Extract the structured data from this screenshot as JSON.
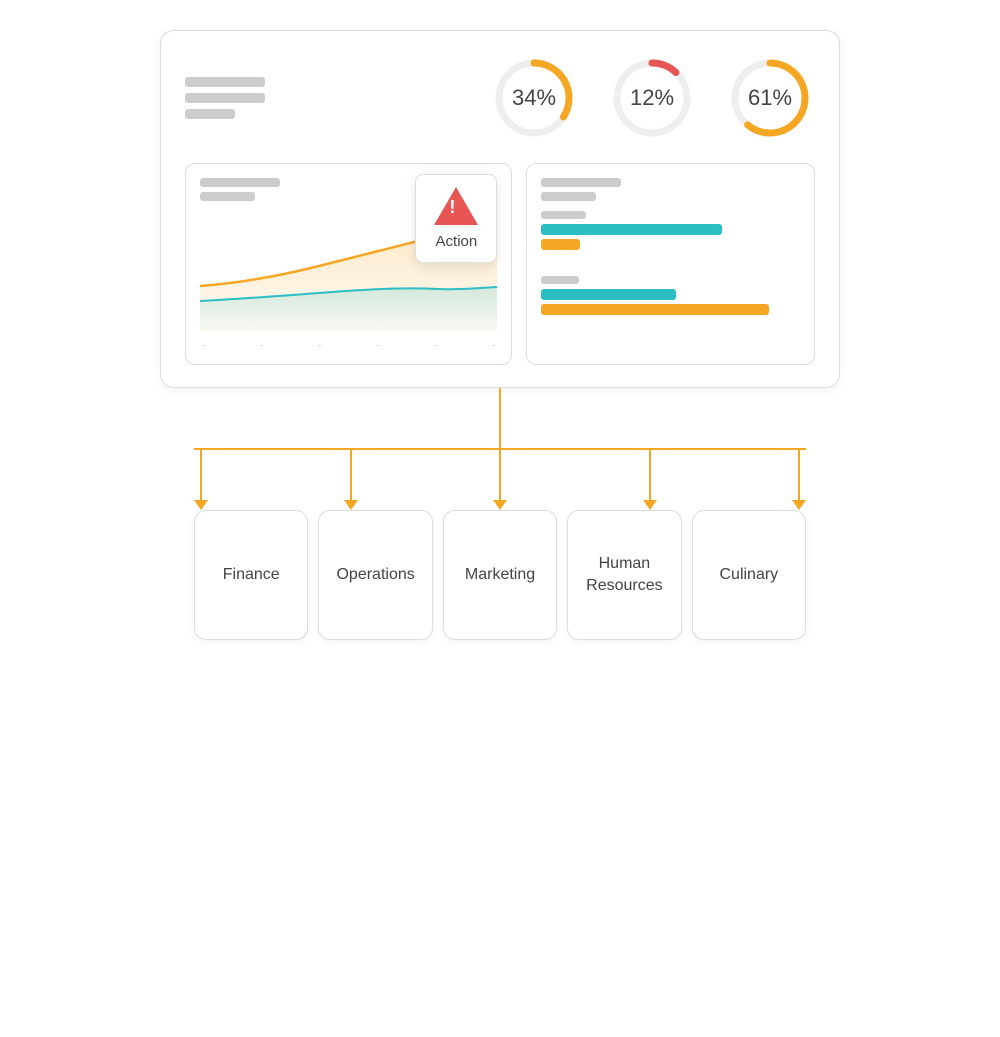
{
  "gauges": [
    {
      "id": "gauge1",
      "value": 34,
      "label": "34%",
      "color": "#f5a623",
      "bg": "#eee",
      "pct": 34
    },
    {
      "id": "gauge2",
      "value": 12,
      "label": "12%",
      "color": "#e85555",
      "bg": "#eee",
      "pct": 12
    },
    {
      "id": "gauge3",
      "value": 61,
      "label": "61%",
      "color": "#f5a623",
      "bg": "#eee",
      "pct": 61
    }
  ],
  "action": {
    "label": "Action"
  },
  "chart": {
    "x_labels": [
      "-",
      "-",
      "-",
      "-",
      "-",
      "-"
    ]
  },
  "bars": [
    {
      "id": "bar-group-1",
      "rows": [
        {
          "color": "teal",
          "width": "70%"
        },
        {
          "color": "gold",
          "width": "15%"
        }
      ]
    },
    {
      "id": "bar-group-2",
      "rows": [
        {
          "color": "teal",
          "width": "52%"
        },
        {
          "color": "gold",
          "width": "88%"
        }
      ]
    }
  ],
  "departments": [
    {
      "id": "finance",
      "label": "Finance"
    },
    {
      "id": "operations",
      "label": "Operations"
    },
    {
      "id": "marketing",
      "label": "Marketing"
    },
    {
      "id": "human-resources",
      "label": "Human\nResources"
    },
    {
      "id": "culinary",
      "label": "Culinary"
    }
  ]
}
